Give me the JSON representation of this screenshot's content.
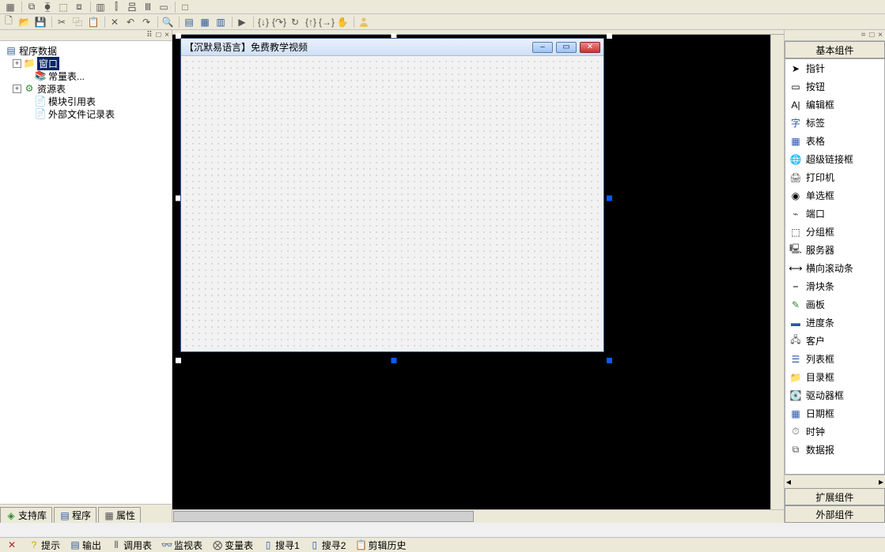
{
  "tree": {
    "root": "程序数据",
    "items": [
      {
        "label": "窗口",
        "selected": true
      },
      {
        "label": "常量表..."
      },
      {
        "label": "资源表"
      },
      {
        "label": "模块引用表"
      },
      {
        "label": "外部文件记录表"
      }
    ]
  },
  "left_tabs": [
    {
      "label": "支持库"
    },
    {
      "label": "程序"
    },
    {
      "label": "属性"
    }
  ],
  "form": {
    "title": "【沉默易语言】免费教学视频",
    "min_label": "–",
    "max_label": "▭",
    "close_label": "✕"
  },
  "toolbox": {
    "header": "基本组件",
    "items": [
      {
        "label": "指针"
      },
      {
        "label": "按钮"
      },
      {
        "label": "编辑框"
      },
      {
        "label": "标签"
      },
      {
        "label": "表格"
      },
      {
        "label": "超级链接框"
      },
      {
        "label": "打印机"
      },
      {
        "label": "单选框"
      },
      {
        "label": "端口"
      },
      {
        "label": "分组框"
      },
      {
        "label": "服务器"
      },
      {
        "label": "横向滚动条"
      },
      {
        "label": "滑块条"
      },
      {
        "label": "画板"
      },
      {
        "label": "进度条"
      },
      {
        "label": "客户"
      },
      {
        "label": "列表框"
      },
      {
        "label": "目录框"
      },
      {
        "label": "驱动器框"
      },
      {
        "label": "日期框"
      },
      {
        "label": "时钟"
      },
      {
        "label": "数据报"
      }
    ],
    "stack2": "扩展组件",
    "stack3": "外部组件"
  },
  "bottom_tabs": [
    {
      "label": "提示"
    },
    {
      "label": "输出"
    },
    {
      "label": "调用表"
    },
    {
      "label": "监视表"
    },
    {
      "label": "变量表"
    },
    {
      "label": "搜寻1"
    },
    {
      "label": "搜寻2"
    },
    {
      "label": "剪辑历史"
    }
  ],
  "panel_header_glyph": "⠿ □ ×",
  "right_header_glyph": "= □ ×"
}
